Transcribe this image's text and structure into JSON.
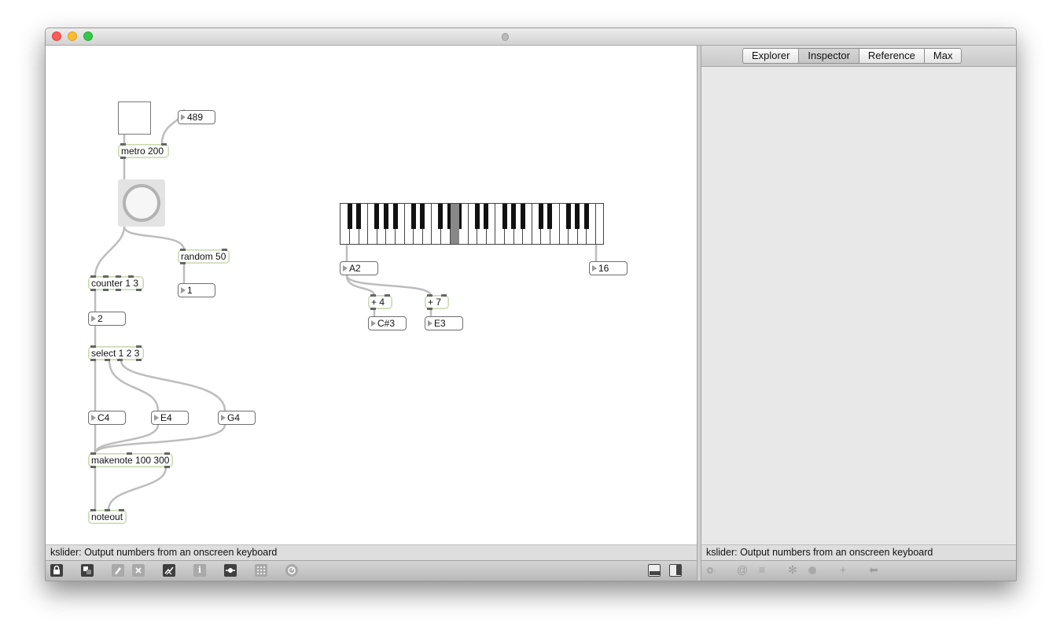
{
  "window": {
    "traffic_lights": [
      "close",
      "minimize",
      "zoom"
    ]
  },
  "patch": {
    "objects": {
      "number_489": "489",
      "metro": "metro 200",
      "random": "random 50",
      "number_random_out": "1",
      "counter": "counter 1 3",
      "number_counter_out": "2",
      "select": "select 1 2 3",
      "c4": "C4",
      "e4": "E4",
      "g4": "G4",
      "makenote": "makenote 100 300",
      "noteout": "noteout",
      "kslider_note": "A2",
      "kslider_velocity": "16",
      "plus4": "+ 4",
      "plus7": "+ 7",
      "csharp3": "C#3",
      "e3": "E3"
    },
    "kslider": {
      "white_keys": 29,
      "pressed_key": "A2"
    }
  },
  "sidebar": {
    "tabs": [
      {
        "label": "Explorer",
        "active": false
      },
      {
        "label": "Inspector",
        "active": true
      },
      {
        "label": "Reference",
        "active": false
      },
      {
        "label": "Max",
        "active": false
      }
    ]
  },
  "status": {
    "left": "kslider: Output numbers from an onscreen keyboard",
    "right": "kslider: Output numbers from an onscreen keyboard"
  },
  "toolbar_left": {
    "icons": [
      "lock-icon",
      "presentation-icon",
      "paint-icon",
      "clear-icon",
      "debug-icon",
      "info-icon",
      "snap-icon",
      "grid-icon",
      "clue-icon",
      "bottom-panel-icon",
      "right-panel-icon"
    ],
    "info_glyph": "i"
  },
  "toolbar_right": {
    "icons": [
      "gear-icon",
      "at-icon",
      "list-icon",
      "snowflake-icon",
      "settings-icon",
      "plus-icon",
      "back-arrow-icon"
    ],
    "at_glyph": "@",
    "list_glyph": "≡",
    "snowflake_glyph": "✻",
    "plus_glyph": "+",
    "back_glyph": "⬅"
  },
  "colors": {
    "message_border": "#c9d8b1",
    "number_border": "#6e6e6e",
    "cord": "#bdbdbd",
    "panel_bg": "#e8e8e8"
  }
}
